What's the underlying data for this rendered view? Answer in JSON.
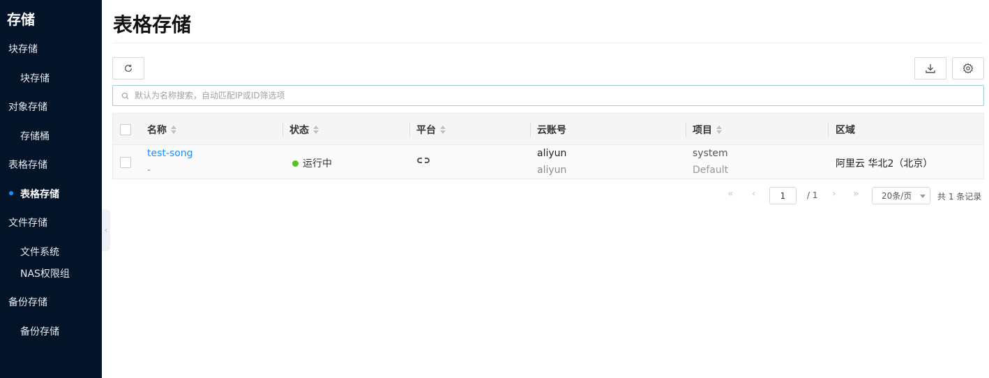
{
  "sidebar": {
    "title": "存储",
    "groups": [
      {
        "label": "块存储",
        "items": [
          {
            "label": "块存储"
          }
        ]
      },
      {
        "label": "对象存储",
        "items": [
          {
            "label": "存储桶"
          }
        ]
      },
      {
        "label": "表格存储",
        "items": [
          {
            "label": "表格存储",
            "active": true
          }
        ]
      },
      {
        "label": "文件存储",
        "items": [
          {
            "label": "文件系统"
          },
          {
            "label": "NAS权限组"
          }
        ]
      },
      {
        "label": "备份存储",
        "items": [
          {
            "label": "备份存储"
          }
        ]
      }
    ]
  },
  "page": {
    "title": "表格存储"
  },
  "toolbar": {
    "refresh_icon": "refresh-icon",
    "download_icon": "download-icon",
    "settings_icon": "gear-icon"
  },
  "search": {
    "placeholder": "默认为名称搜索，自动匹配IP或ID筛选项"
  },
  "table": {
    "columns": [
      "名称",
      "状态",
      "平台",
      "云账号",
      "项目",
      "区域"
    ],
    "rows": [
      {
        "name": "test-song",
        "name_sub": "-",
        "status": "运行中",
        "platform_icon": "link-icon",
        "account": "aliyun",
        "account_sub": "aliyun",
        "project": "system",
        "project_sub": "Default",
        "region": "阿里云 华北2（北京）"
      }
    ]
  },
  "pagination": {
    "current_page": "1",
    "total_pages": "/ 1",
    "page_size": "20条/页",
    "total": "共 1 条记录"
  },
  "colors": {
    "sidebar_bg": "#031428",
    "accent": "#1890ff",
    "status_running": "#52c41a"
  }
}
